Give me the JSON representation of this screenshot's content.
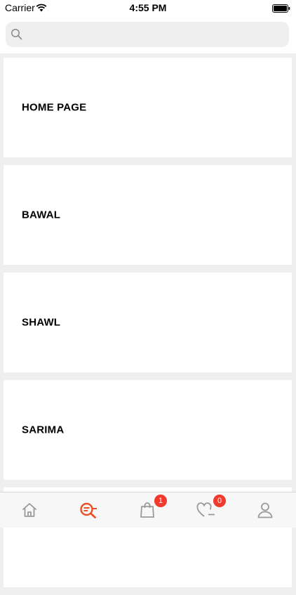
{
  "status_bar": {
    "carrier": "Carrier",
    "time": "4:55 PM"
  },
  "search": {
    "placeholder": "",
    "value": ""
  },
  "categories": [
    {
      "label": "HOME PAGE"
    },
    {
      "label": "BAWAL"
    },
    {
      "label": "SHAWL"
    },
    {
      "label": "SARIMA"
    }
  ],
  "tab_bar": {
    "active_color": "#e8502a",
    "inactive_color": "#9a9a9a",
    "items": [
      {
        "icon": "home-icon"
      },
      {
        "icon": "search-list-icon",
        "active": true
      },
      {
        "icon": "shopping-bag-icon",
        "badge": "1"
      },
      {
        "icon": "wishlist-heart-icon",
        "badge": "0"
      },
      {
        "icon": "profile-icon"
      }
    ]
  }
}
